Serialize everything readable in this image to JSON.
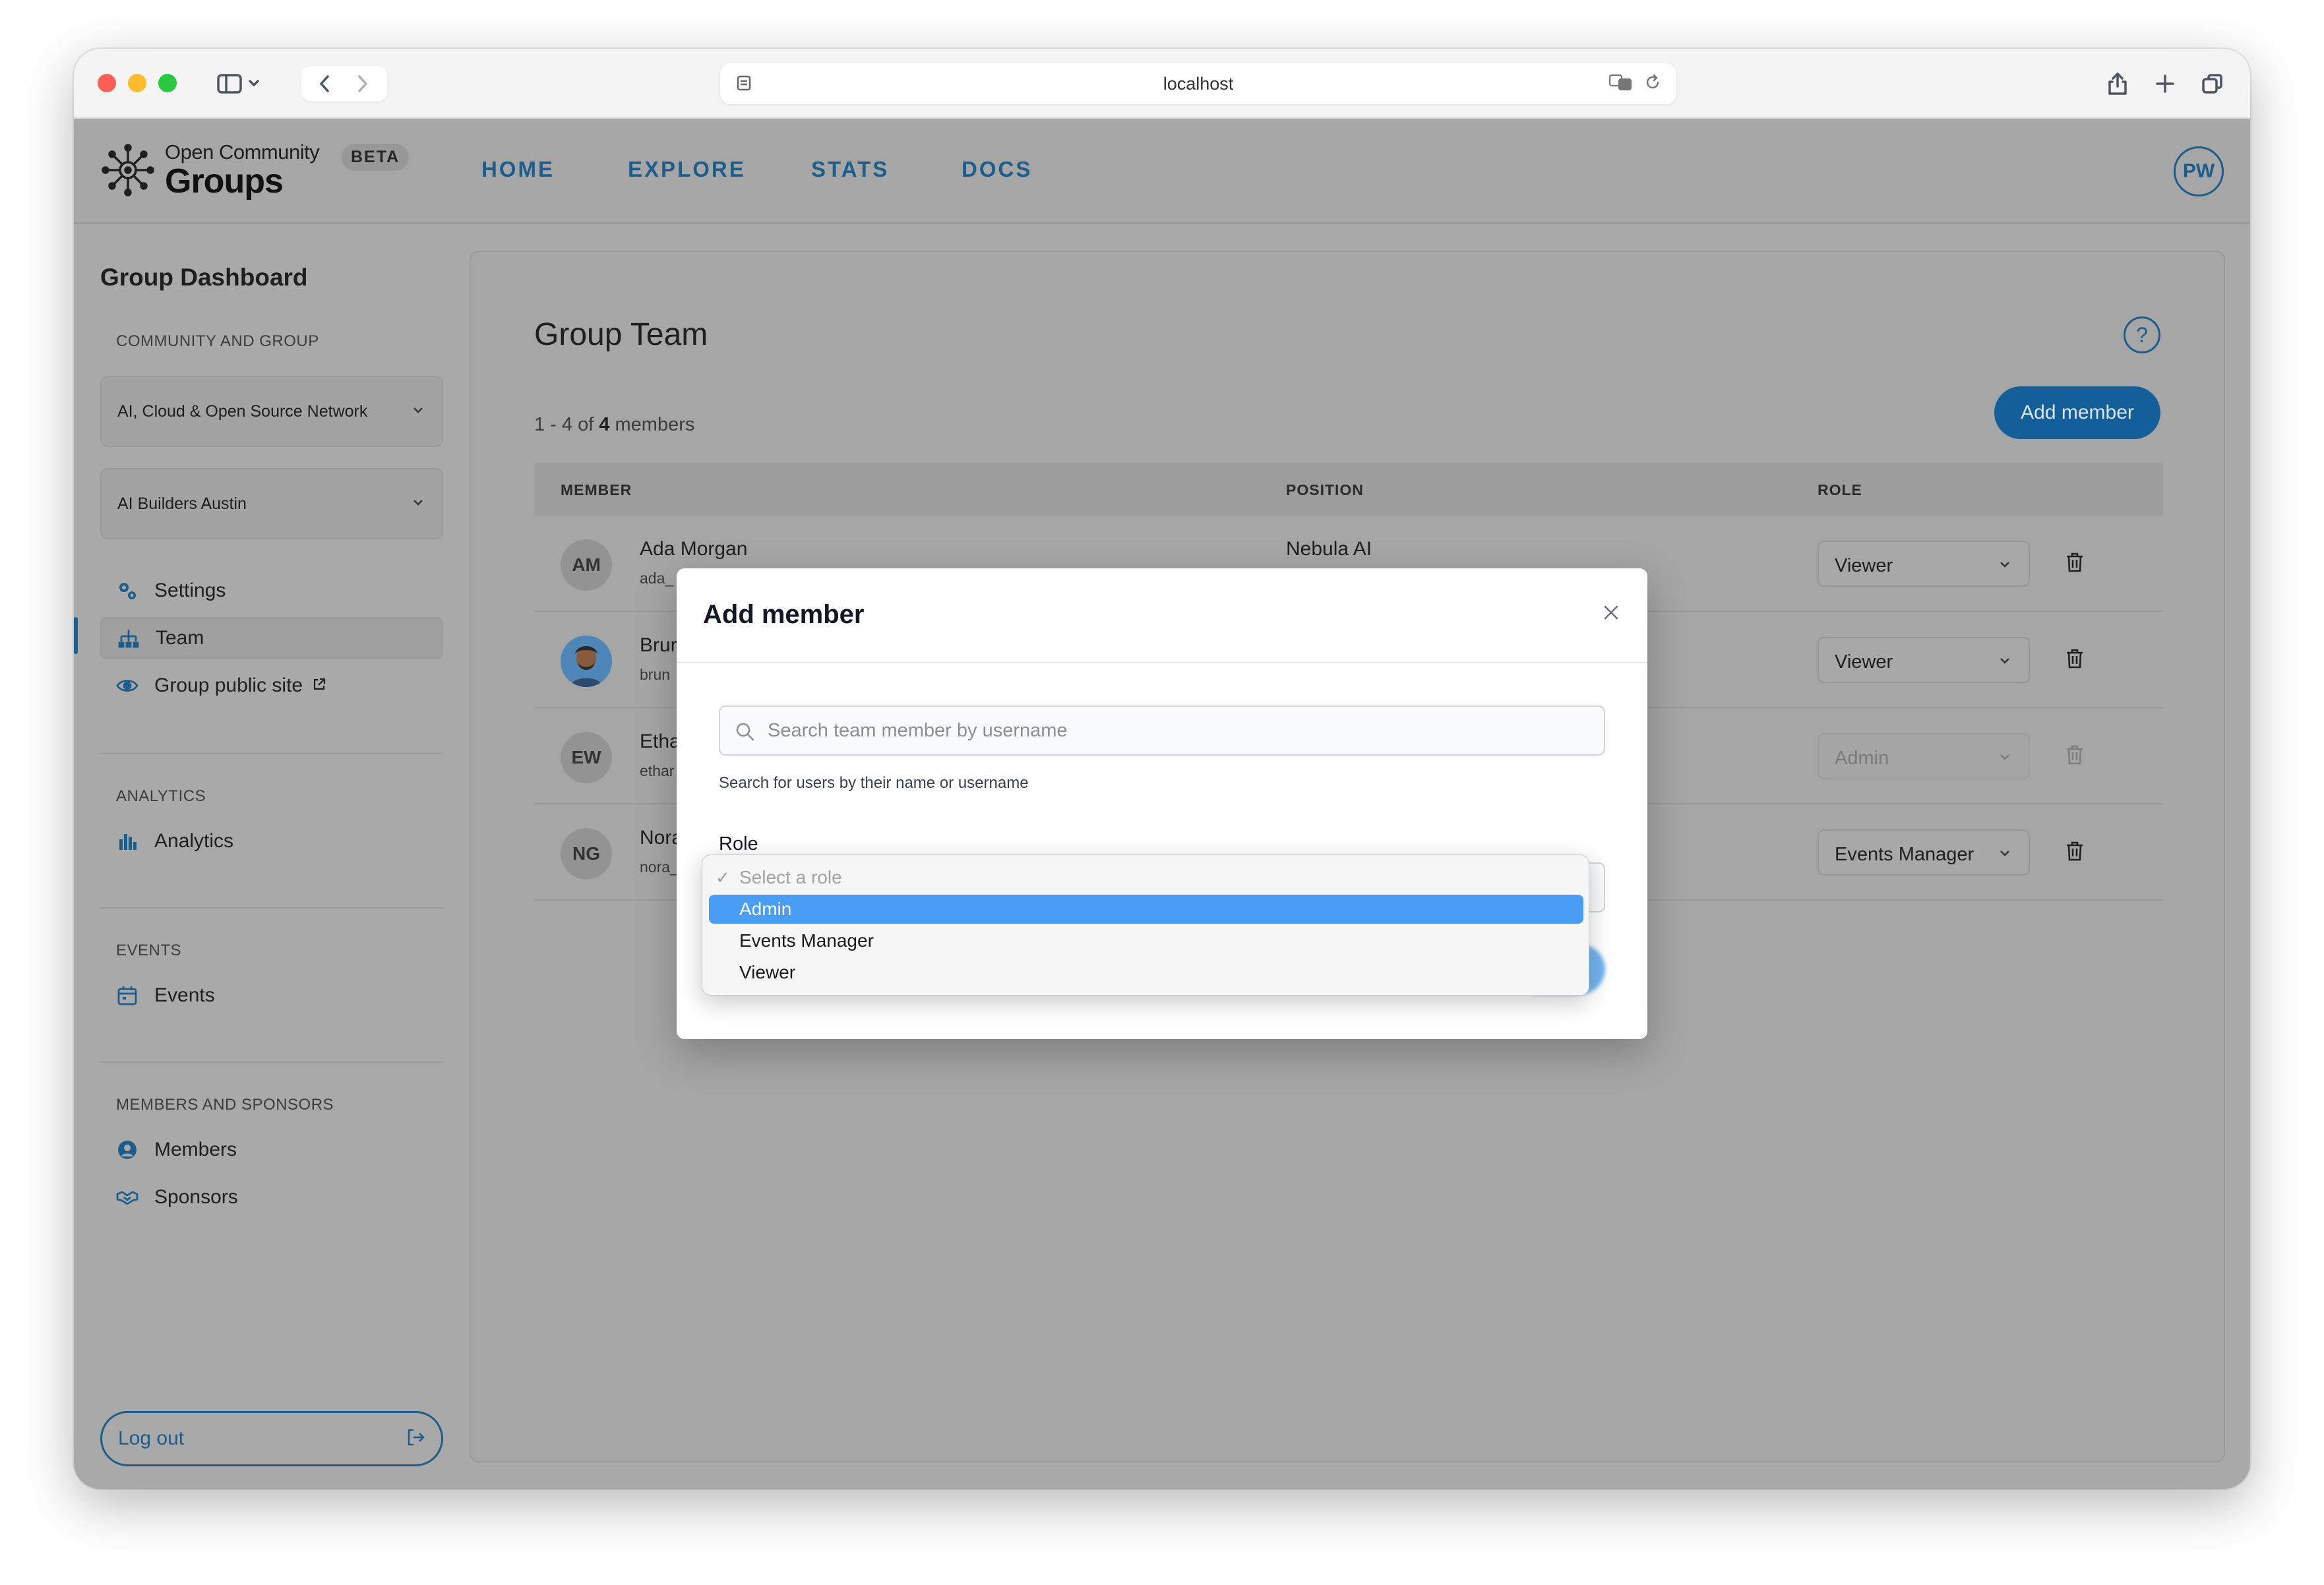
{
  "browser": {
    "url": "localhost"
  },
  "app": {
    "logo": {
      "line1": "Open Community",
      "line2": "Groups",
      "badge": "BETA"
    },
    "nav": [
      "HOME",
      "EXPLORE",
      "STATS",
      "DOCS"
    ],
    "user_initials": "PW",
    "accent": "#1d5d8c"
  },
  "sidebar": {
    "title": "Group Dashboard",
    "sections": {
      "community": "COMMUNITY AND GROUP",
      "analytics": "ANALYTICS",
      "events": "EVENTS",
      "members": "MEMBERS AND SPONSORS"
    },
    "community_select": "AI, Cloud & Open Source Network",
    "group_select": "AI Builders Austin",
    "items": {
      "settings": "Settings",
      "team": "Team",
      "public_site": "Group public site",
      "analytics": "Analytics",
      "events": "Events",
      "members": "Members",
      "sponsors": "Sponsors"
    },
    "logout": "Log out"
  },
  "main": {
    "title": "Group Team",
    "count_prefix": "1 - 4 of ",
    "count_total": "4",
    "count_suffix": " members",
    "add_button": "Add member",
    "columns": {
      "member": "MEMBER",
      "position": "POSITION",
      "role": "ROLE"
    },
    "rows": [
      {
        "initials": "AM",
        "name": "Ada Morgan",
        "username": "ada_",
        "position": "Nebula AI",
        "role": "Viewer",
        "avatar": "initials"
      },
      {
        "initials": "",
        "name": "Brur",
        "username": "brun",
        "position": "",
        "role": "Viewer",
        "avatar": "photo"
      },
      {
        "initials": "EW",
        "name": "Etha",
        "username": "ethar",
        "position": "",
        "role": "Admin",
        "avatar": "initials"
      },
      {
        "initials": "NG",
        "name": "Nora",
        "username": "nora_",
        "position": "",
        "role": "Events Manager",
        "avatar": "initials"
      }
    ]
  },
  "modal": {
    "title": "Add member",
    "search_placeholder": "Search team member by username",
    "search_hint": "Search for users by their name or username",
    "role_label": "Role",
    "role_options": [
      {
        "label": "Select a role",
        "state": "placeholder",
        "check": "✓"
      },
      {
        "label": "Admin",
        "state": "highlighted",
        "check": ""
      },
      {
        "label": "Events Manager",
        "state": "normal",
        "check": ""
      },
      {
        "label": "Viewer",
        "state": "normal",
        "check": ""
      }
    ]
  }
}
